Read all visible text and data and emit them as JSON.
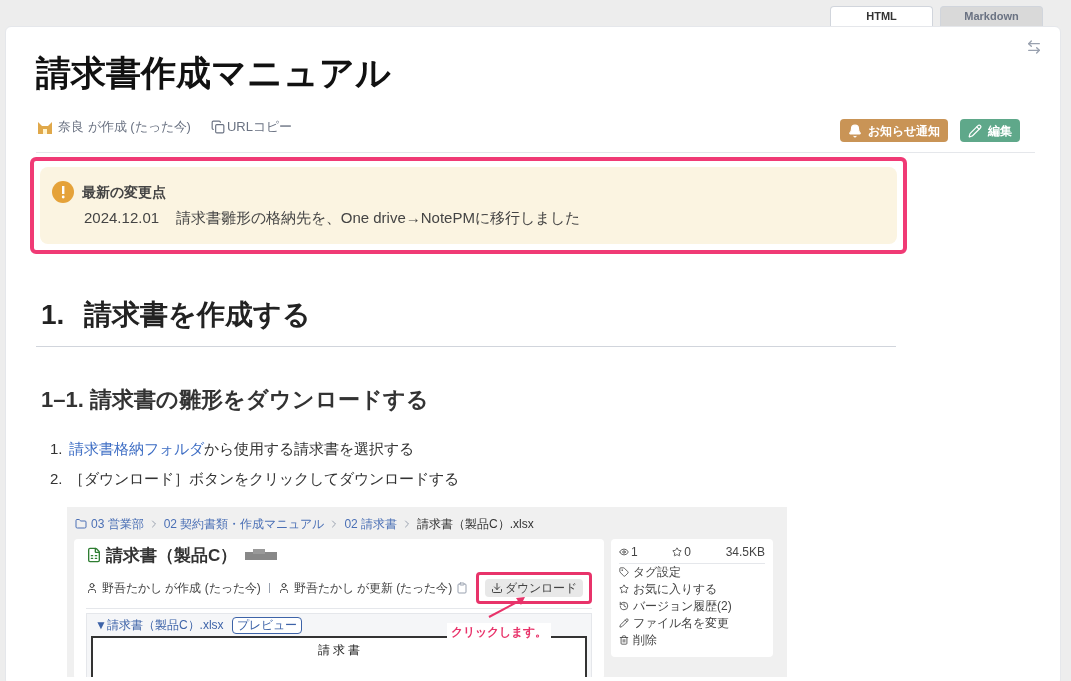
{
  "view_tabs": [
    {
      "label": "HTML",
      "selected": true
    },
    {
      "label": "Markdown",
      "selected": false
    }
  ],
  "page": {
    "title": "請求書作成マニュアル",
    "author": "奈良 が作成 (たった今)",
    "copy_link": "URLコピー",
    "buttons": [
      {
        "kind": "notify",
        "label": "お知らせ通知"
      },
      {
        "kind": "edit",
        "label": "編集"
      }
    ]
  },
  "notice": {
    "title": "最新の変更点",
    "date": "2024.12.01",
    "text": "請求書雛形の格納先を、One drive→NotePMに移行しました"
  },
  "heading_1": {
    "number": "1.",
    "text": "請求書を作成する"
  },
  "heading_2": "1–1. 請求書の雛形をダウンロードする",
  "steps": [
    {
      "number": "1.",
      "link": "請求書格納フォルダ",
      "text": "から使用する請求書を選択する"
    },
    {
      "number": "2.",
      "text": "［ダウンロード］ボタンをクリックしてダウンロードする"
    }
  ],
  "screenshot": {
    "breadcrumb": [
      "03 営業部",
      "02 契約書類・作成マニュアル",
      "02 請求書",
      "請求書（製品C）.xlsx"
    ],
    "file_title": "請求書（製品C）",
    "creator": "野吾たかし が作成 (たった今)",
    "updater": "野吾たかし が更新 (たった今)",
    "download": "ダウンロード",
    "file_toggle": "▼請求書（製品C）.xlsx",
    "preview": "プレビュー",
    "callout": "クリックします。",
    "preview_heading": "請 求 書",
    "stats": [
      {
        "kind": "views",
        "value": "1"
      },
      {
        "kind": "stars",
        "value": "0"
      },
      {
        "kind": "size",
        "value": "34.5KB"
      }
    ],
    "menu": [
      {
        "kind": "tag",
        "label": "タグ設定"
      },
      {
        "kind": "star",
        "label": "お気に入りする"
      },
      {
        "kind": "history",
        "label": "バージョン履歴(2)"
      },
      {
        "kind": "rename",
        "label": "ファイル名を変更"
      },
      {
        "kind": "delete",
        "label": "削除"
      }
    ]
  }
}
